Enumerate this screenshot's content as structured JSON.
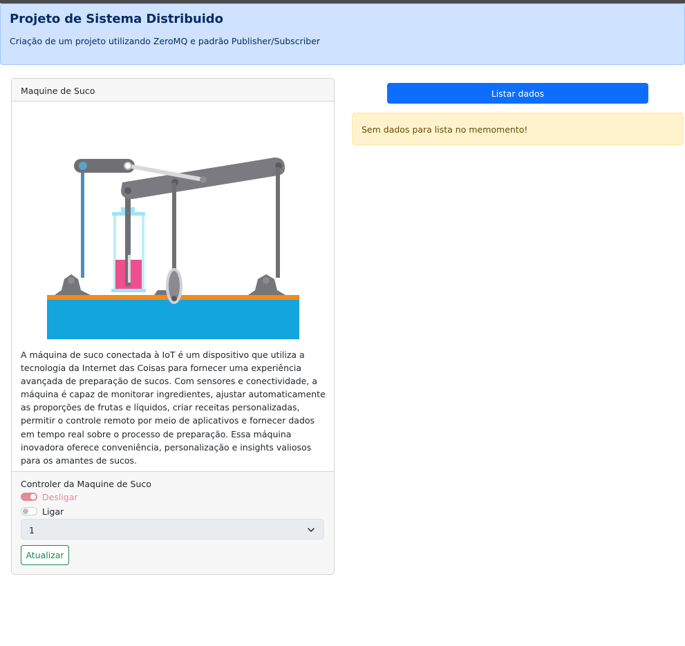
{
  "header": {
    "title": "Projeto de Sistema Distribuido",
    "subtitle": "Criação de um projeto utilizando ZeroMQ e padrão Publisher/Subscriber"
  },
  "card": {
    "title": "Maquine de Suco",
    "description": "A máquina de suco conectada à IoT é um dispositivo que utiliza a tecnologia da Internet das Coisas para fornecer uma experiência avançada de preparação de sucos. Com sensores e conectividade, a máquina é capaz de monitorar ingredientes, ajustar automaticamente as proporções de frutas e líquidos, criar receitas personalizadas, permitir o controle remoto por meio de aplicativos e fornecer dados em tempo real sobre o processo de preparação. Essa máquina inovadora oferece conveniência, personalização e insights valiosos para os amantes de sucos."
  },
  "controller": {
    "title": "Controler da Maquine de Suco",
    "switch_off_label": "Desligar",
    "switch_on_label": "Ligar",
    "select_value": "1",
    "update_button": "Atualizar"
  },
  "list": {
    "button_label": "Listar dados",
    "empty_message": "Sem dados para lista no memomento!"
  },
  "colors": {
    "header_bg": "#cfe2ff",
    "primary": "#0d6efd",
    "success": "#198754",
    "warning_bg": "#fff3cd",
    "juice": "#ee4f8f"
  }
}
